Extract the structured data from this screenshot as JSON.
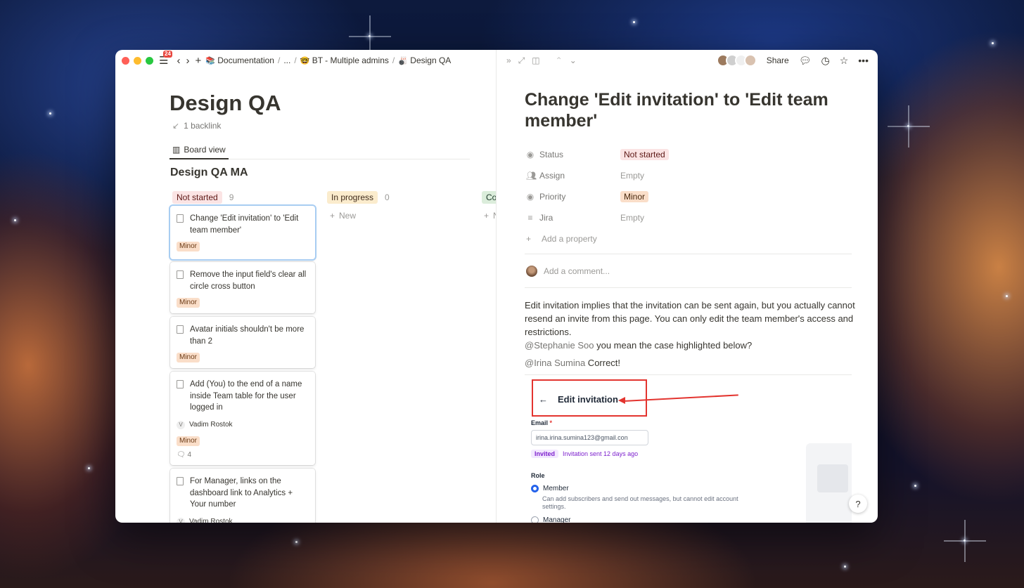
{
  "topbar": {
    "notification_count": "24",
    "breadcrumbs": [
      {
        "icon": "📚",
        "label": "Documentation"
      },
      {
        "label": "..."
      },
      {
        "icon": "🤓",
        "label": "BT - Multiple admins"
      },
      {
        "icon": "🎳",
        "label": "Design QA"
      }
    ],
    "separator": "/"
  },
  "page": {
    "title": "Design QA",
    "backlink": "1 backlink",
    "view_tab": "Board view",
    "board_title": "Design QA MA"
  },
  "columns": [
    {
      "label": "Not started",
      "count": "9",
      "color": "#fbe4e4",
      "text_color": "#5d1715"
    },
    {
      "label": "In progress",
      "count": "0",
      "color": "#fbeccd",
      "text_color": "#402c1b",
      "new_label": "New"
    },
    {
      "label": "Co",
      "count": "",
      "color": "#dbeddb",
      "text_color": "#1c3829",
      "new_label": "N"
    }
  ],
  "cards": [
    {
      "title": "Change 'Edit invitation' to 'Edit team member'",
      "tag": "Minor"
    },
    {
      "title": "Remove the input field's clear all circle cross button",
      "tag": "Minor"
    },
    {
      "title": "Avatar initials shouldn't be more than 2",
      "tag": "Minor"
    },
    {
      "title": "Add (You) to the end of a name inside Team table for the user logged in",
      "assignee_initial": "V",
      "assignee": "Vadim Rostok",
      "tag": "Minor",
      "comments": "4"
    },
    {
      "title": "For Manager, links on the dashboard link to Analytics + Your number",
      "assignee_initial": "V",
      "assignee": "Vadim Rostok"
    }
  ],
  "right_pane": {
    "share_label": "Share",
    "title": "Change 'Edit invitation' to 'Edit team member'",
    "properties": [
      {
        "icon": "status-icon",
        "name": "Status",
        "value": "Not started",
        "style": "ns"
      },
      {
        "icon": "people-icon",
        "name": "Assign",
        "value": "Empty",
        "style": "empty"
      },
      {
        "icon": "priority-icon",
        "name": "Priority",
        "value": "Minor",
        "style": "mn"
      },
      {
        "icon": "list-icon",
        "name": "Jira",
        "value": "Empty",
        "style": "empty"
      }
    ],
    "add_property": "Add a property",
    "comment_placeholder": "Add a comment...",
    "body": {
      "paragraph": "Edit invitation implies that the invitation can be sent again, but you actually cannot resend an invite from this page. You can only edit the team member's access and restrictions.",
      "mention1": "@Stephanie Soo",
      "reply1": " you mean the case highlighted below?",
      "mention2": "@Irina Sumina",
      "reply2": " Correct!"
    },
    "embed": {
      "heading": "Edit invitation",
      "email_label": "Email",
      "required_mark": "*",
      "email_value": "irina.irina.sumina123@gmail.con",
      "invited_chip": "Invited",
      "invited_text": "Invitation sent 12 days ago",
      "role_label": "Role",
      "option1": "Member",
      "option1_desc": "Can add subscribers and send out messages, but cannot edit account settings.",
      "option2": "Manager"
    },
    "help": "?"
  }
}
